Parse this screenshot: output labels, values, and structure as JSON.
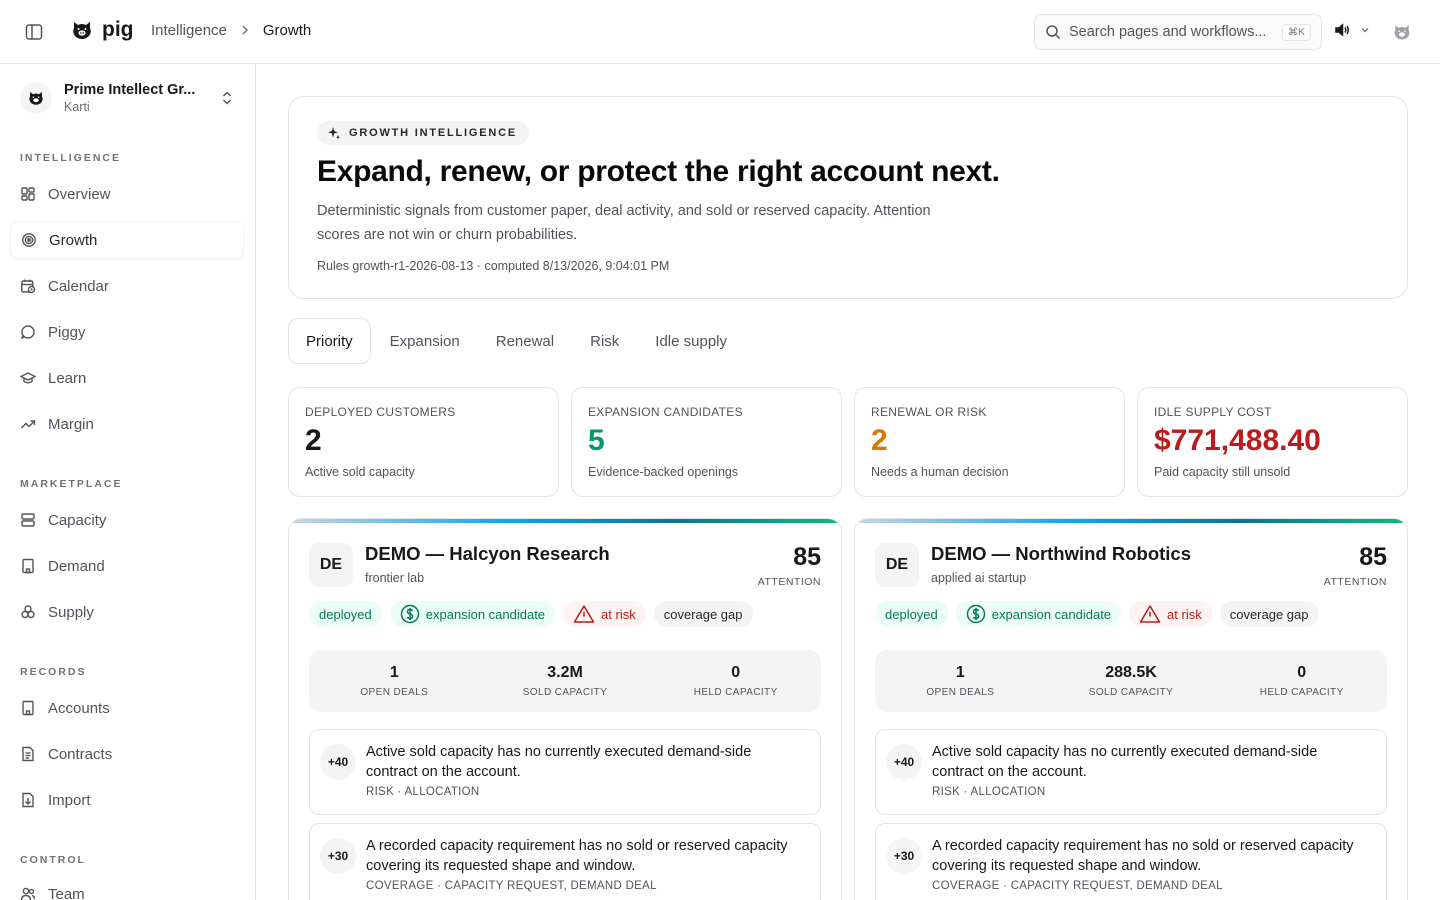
{
  "app": {
    "name": "pig"
  },
  "breadcrumb": {
    "parent": "Intelligence",
    "current": "Growth"
  },
  "search": {
    "placeholder": "Search pages and workflows...",
    "shortcut": "⌘K"
  },
  "org": {
    "name": "Prime Intellect Gr...",
    "user": "Karti"
  },
  "sidebar": {
    "sections": [
      {
        "label": "INTELLIGENCE",
        "items": [
          "Overview",
          "Growth",
          "Calendar",
          "Piggy",
          "Learn",
          "Margin"
        ]
      },
      {
        "label": "MARKETPLACE",
        "items": [
          "Capacity",
          "Demand",
          "Supply"
        ]
      },
      {
        "label": "RECORDS",
        "items": [
          "Accounts",
          "Contracts",
          "Import"
        ]
      },
      {
        "label": "CONTROL",
        "items": [
          "Team"
        ]
      }
    ],
    "active": "Growth"
  },
  "hero": {
    "badge": "GROWTH INTELLIGENCE",
    "title": "Expand, renew, or protect the right account next.",
    "description": "Deterministic signals from customer paper, deal activity, and sold or reserved capacity. Attention scores are not win or churn probabilities.",
    "meta": "Rules growth-r1-2026-08-13 · computed 8/13/2026, 9:04:01 PM"
  },
  "tabs": [
    "Priority",
    "Expansion",
    "Renewal",
    "Risk",
    "Idle supply"
  ],
  "active_tab": "Priority",
  "stats": [
    {
      "label": "DEPLOYED CUSTOMERS",
      "value": "2",
      "sub": "Active sold capacity",
      "color": "#18181b"
    },
    {
      "label": "EXPANSION CANDIDATES",
      "value": "5",
      "sub": "Evidence-backed openings",
      "color": "#059669"
    },
    {
      "label": "RENEWAL OR RISK",
      "value": "2",
      "sub": "Needs a human decision",
      "color": "#d97706"
    },
    {
      "label": "IDLE SUPPLY COST",
      "value": "$771,488.40",
      "sub": "Paid capacity still unsold",
      "color": "#b91c1c"
    }
  ],
  "cards": [
    {
      "initials": "DE",
      "name": "DEMO — Halcyon Research",
      "segment": "frontier lab",
      "score": "85",
      "score_label": "ATTENTION",
      "tags": [
        "deployed",
        "expansion candidate",
        "at risk",
        "coverage gap"
      ],
      "metrics": [
        {
          "value": "1",
          "label": "OPEN DEALS"
        },
        {
          "value": "3.2M",
          "label": "SOLD CAPACITY"
        },
        {
          "value": "0",
          "label": "HELD CAPACITY"
        }
      ],
      "signals": [
        {
          "points": "+40",
          "text": "Active sold capacity has no currently executed demand-side contract on the account.",
          "meta": "RISK · ALLOCATION"
        },
        {
          "points": "+30",
          "text": "A recorded capacity requirement has no sold or reserved capacity covering its requested shape and window.",
          "meta": "COVERAGE · CAPACITY REQUEST, DEMAND DEAL"
        }
      ]
    },
    {
      "initials": "DE",
      "name": "DEMO — Northwind Robotics",
      "segment": "applied ai startup",
      "score": "85",
      "score_label": "ATTENTION",
      "tags": [
        "deployed",
        "expansion candidate",
        "at risk",
        "coverage gap"
      ],
      "metrics": [
        {
          "value": "1",
          "label": "OPEN DEALS"
        },
        {
          "value": "288.5K",
          "label": "SOLD CAPACITY"
        },
        {
          "value": "0",
          "label": "HELD CAPACITY"
        }
      ],
      "signals": [
        {
          "points": "+40",
          "text": "Active sold capacity has no currently executed demand-side contract on the account.",
          "meta": "RISK · ALLOCATION"
        },
        {
          "points": "+30",
          "text": "A recorded capacity requirement has no sold or reserved capacity covering its requested shape and window.",
          "meta": "COVERAGE · CAPACITY REQUEST, DEMAND DEAL"
        }
      ]
    }
  ]
}
